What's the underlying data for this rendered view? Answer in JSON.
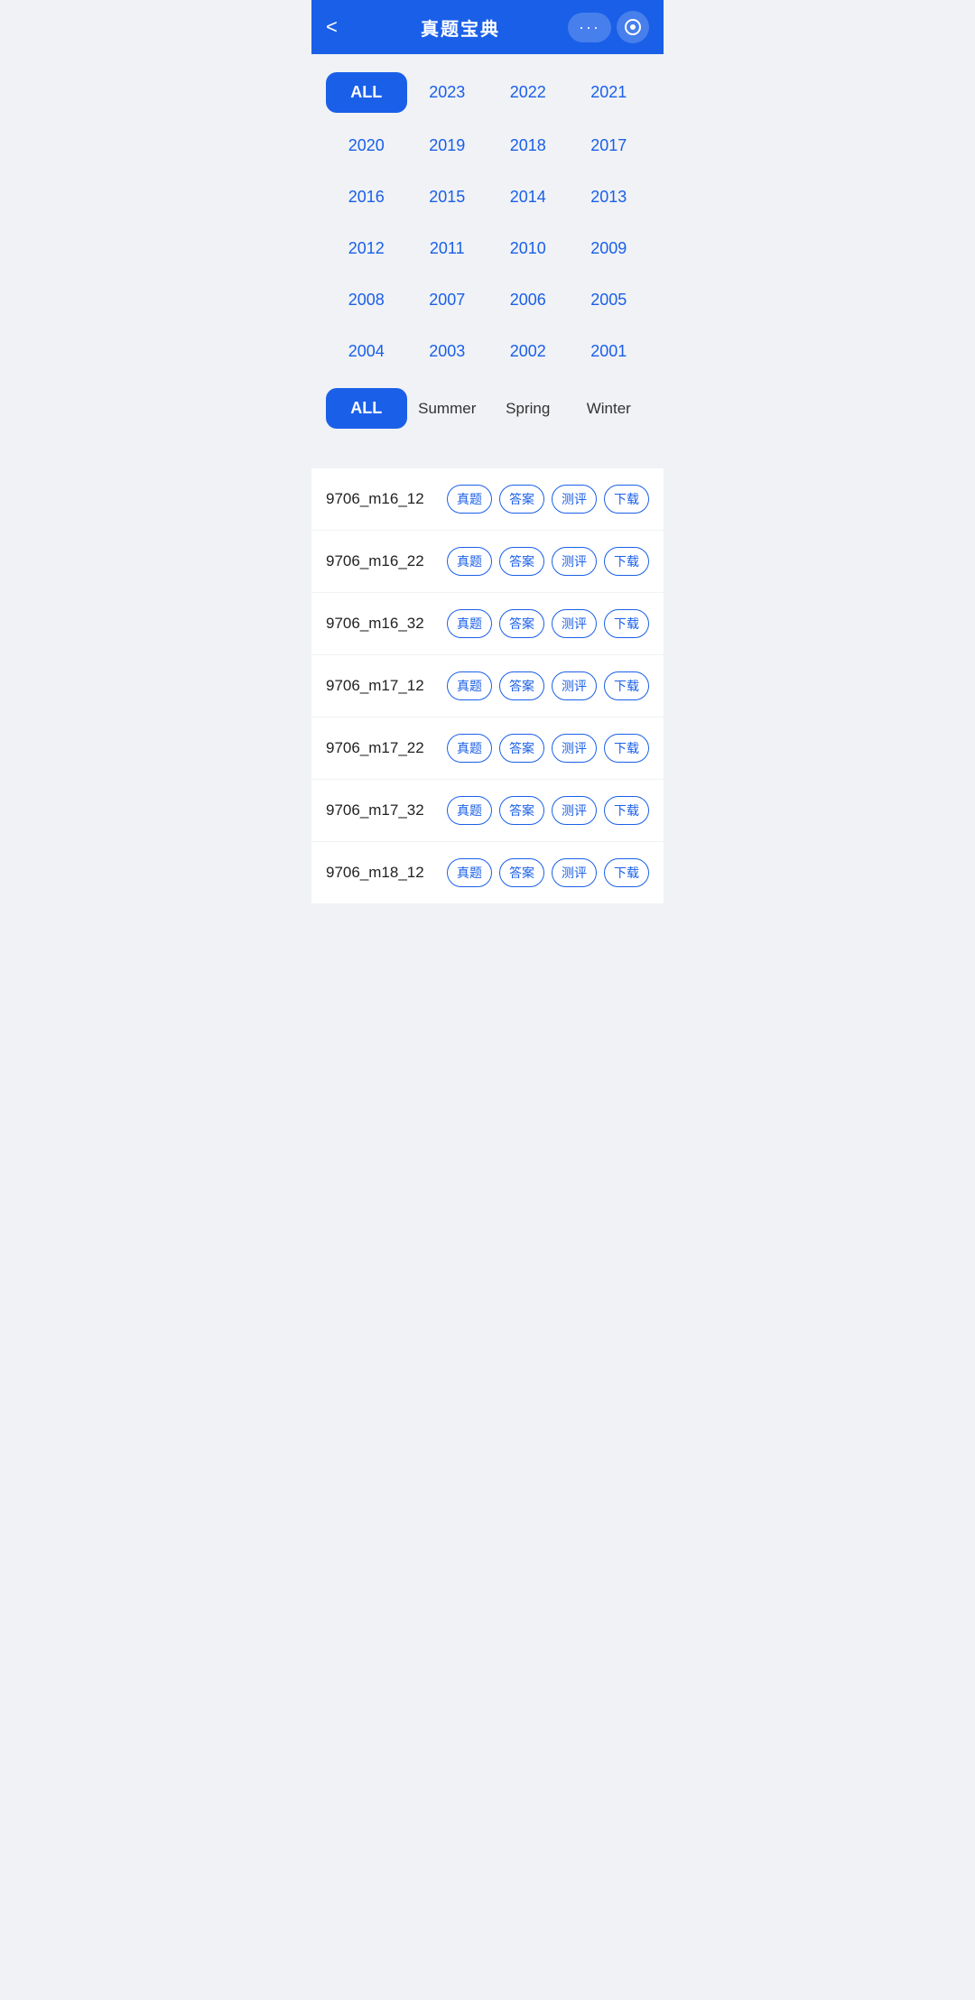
{
  "header": {
    "back_label": "<",
    "title": "真题宝典",
    "dots_label": "···"
  },
  "year_filter": {
    "rows": [
      [
        "ALL",
        "2023",
        "2022",
        "2021"
      ],
      [
        "2020",
        "2019",
        "2018",
        "2017"
      ],
      [
        "2016",
        "2015",
        "2014",
        "2013"
      ],
      [
        "2012",
        "2011",
        "2010",
        "2009"
      ],
      [
        "2008",
        "2007",
        "2006",
        "2005"
      ],
      [
        "2004",
        "2003",
        "2002",
        "2001"
      ]
    ],
    "active": "ALL"
  },
  "season_filter": {
    "items": [
      "ALL",
      "Summer",
      "Spring",
      "Winter"
    ],
    "active": "ALL"
  },
  "exam_list": [
    {
      "name": "9706_m16_12",
      "actions": [
        "真题",
        "答案",
        "测评",
        "下载"
      ]
    },
    {
      "name": "9706_m16_22",
      "actions": [
        "真题",
        "答案",
        "测评",
        "下载"
      ]
    },
    {
      "name": "9706_m16_32",
      "actions": [
        "真题",
        "答案",
        "测评",
        "下载"
      ]
    },
    {
      "name": "9706_m17_12",
      "actions": [
        "真题",
        "答案",
        "测评",
        "下载"
      ]
    },
    {
      "name": "9706_m17_22",
      "actions": [
        "真题",
        "答案",
        "测评",
        "下载"
      ]
    },
    {
      "name": "9706_m17_32",
      "actions": [
        "真题",
        "答案",
        "测评",
        "下载"
      ]
    },
    {
      "name": "9706_m18_12",
      "actions": [
        "真题",
        "答案",
        "测评",
        "下载"
      ]
    }
  ]
}
